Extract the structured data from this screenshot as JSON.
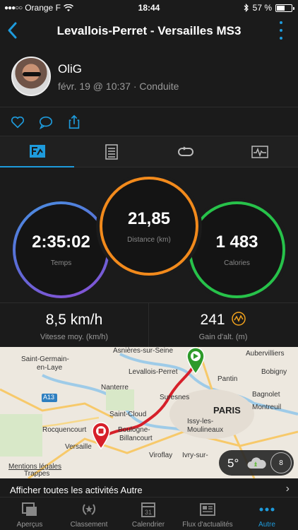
{
  "status_bar": {
    "carrier": "Orange F",
    "time": "18:44",
    "battery_text": "57 %",
    "battery_level": 0.57
  },
  "nav": {
    "title": "Levallois-Perret - Versailles MS3"
  },
  "activity": {
    "user_name": "OliG",
    "meta": "févr. 19 @ 10:37 · Conduite"
  },
  "tabs": [
    {
      "icon": "summary-chart-icon",
      "active": true
    },
    {
      "icon": "details-list-icon",
      "active": false
    },
    {
      "icon": "laps-loop-icon",
      "active": false
    },
    {
      "icon": "graph-monitor-icon",
      "active": false
    }
  ],
  "circles": {
    "time": {
      "value": "2:35:02",
      "label": "Temps",
      "color": "#5b6cd6"
    },
    "distance": {
      "value": "21,85",
      "label": "Distance (km)",
      "color": "#f28a1c"
    },
    "calories": {
      "value": "1 483",
      "label": "Calories",
      "color": "#27c24a"
    }
  },
  "stats": {
    "speed": {
      "value": "8,5 km/h",
      "label": "Vitesse moy. (km/h)"
    },
    "elevation": {
      "value": "241",
      "label": "Gain d'alt. (m)"
    }
  },
  "map": {
    "labels": {
      "asnieres": "Asnières-sur-Seine",
      "aubervilliers": "Aubervilliers",
      "saint_germain": "Saint-Germain-",
      "en_laye": "en-Laye",
      "levallois": "Levallois-Perret",
      "bobigny": "Bobigny",
      "nanterre": "Nanterre",
      "pantin": "Pantin",
      "a13": "A13",
      "suresnes": "Suresnes",
      "bagnolet": "Bagnolet",
      "paris": "PARIS",
      "montreuil": "Montreuil",
      "saint_cloud": "Saint-Cloud",
      "rocquencourt": "Rocquencourt",
      "boulogne": "Boulogne-",
      "billancourt": "Billancourt",
      "issy": "Issy-les-",
      "moulineaux": "Moulineaux",
      "versailles": "Versaille",
      "viroflay": "Viroflay",
      "ivry": "Ivry-sur-",
      "mentions": "Mentions légales",
      "trappes": "Trappes"
    },
    "weather_temp": "5°",
    "wind_speed": "8"
  },
  "all_activities_label": "Afficher toutes les activités Autre",
  "bottom_tabs": [
    {
      "label": "Aperçus",
      "icon": "overview-icon"
    },
    {
      "label": "Classement",
      "icon": "laurel-icon"
    },
    {
      "label": "Calendrier",
      "icon": "calendar-icon",
      "icon_text": "31"
    },
    {
      "label": "Flux d'actualités",
      "icon": "news-icon"
    },
    {
      "label": "Autre",
      "icon": "more-dots-icon",
      "active": true
    }
  ],
  "colors": {
    "accent": "#1e9bdc",
    "route": "#d6202a",
    "start_pin": "#2e9a2a",
    "end_pin": "#d6202a"
  }
}
